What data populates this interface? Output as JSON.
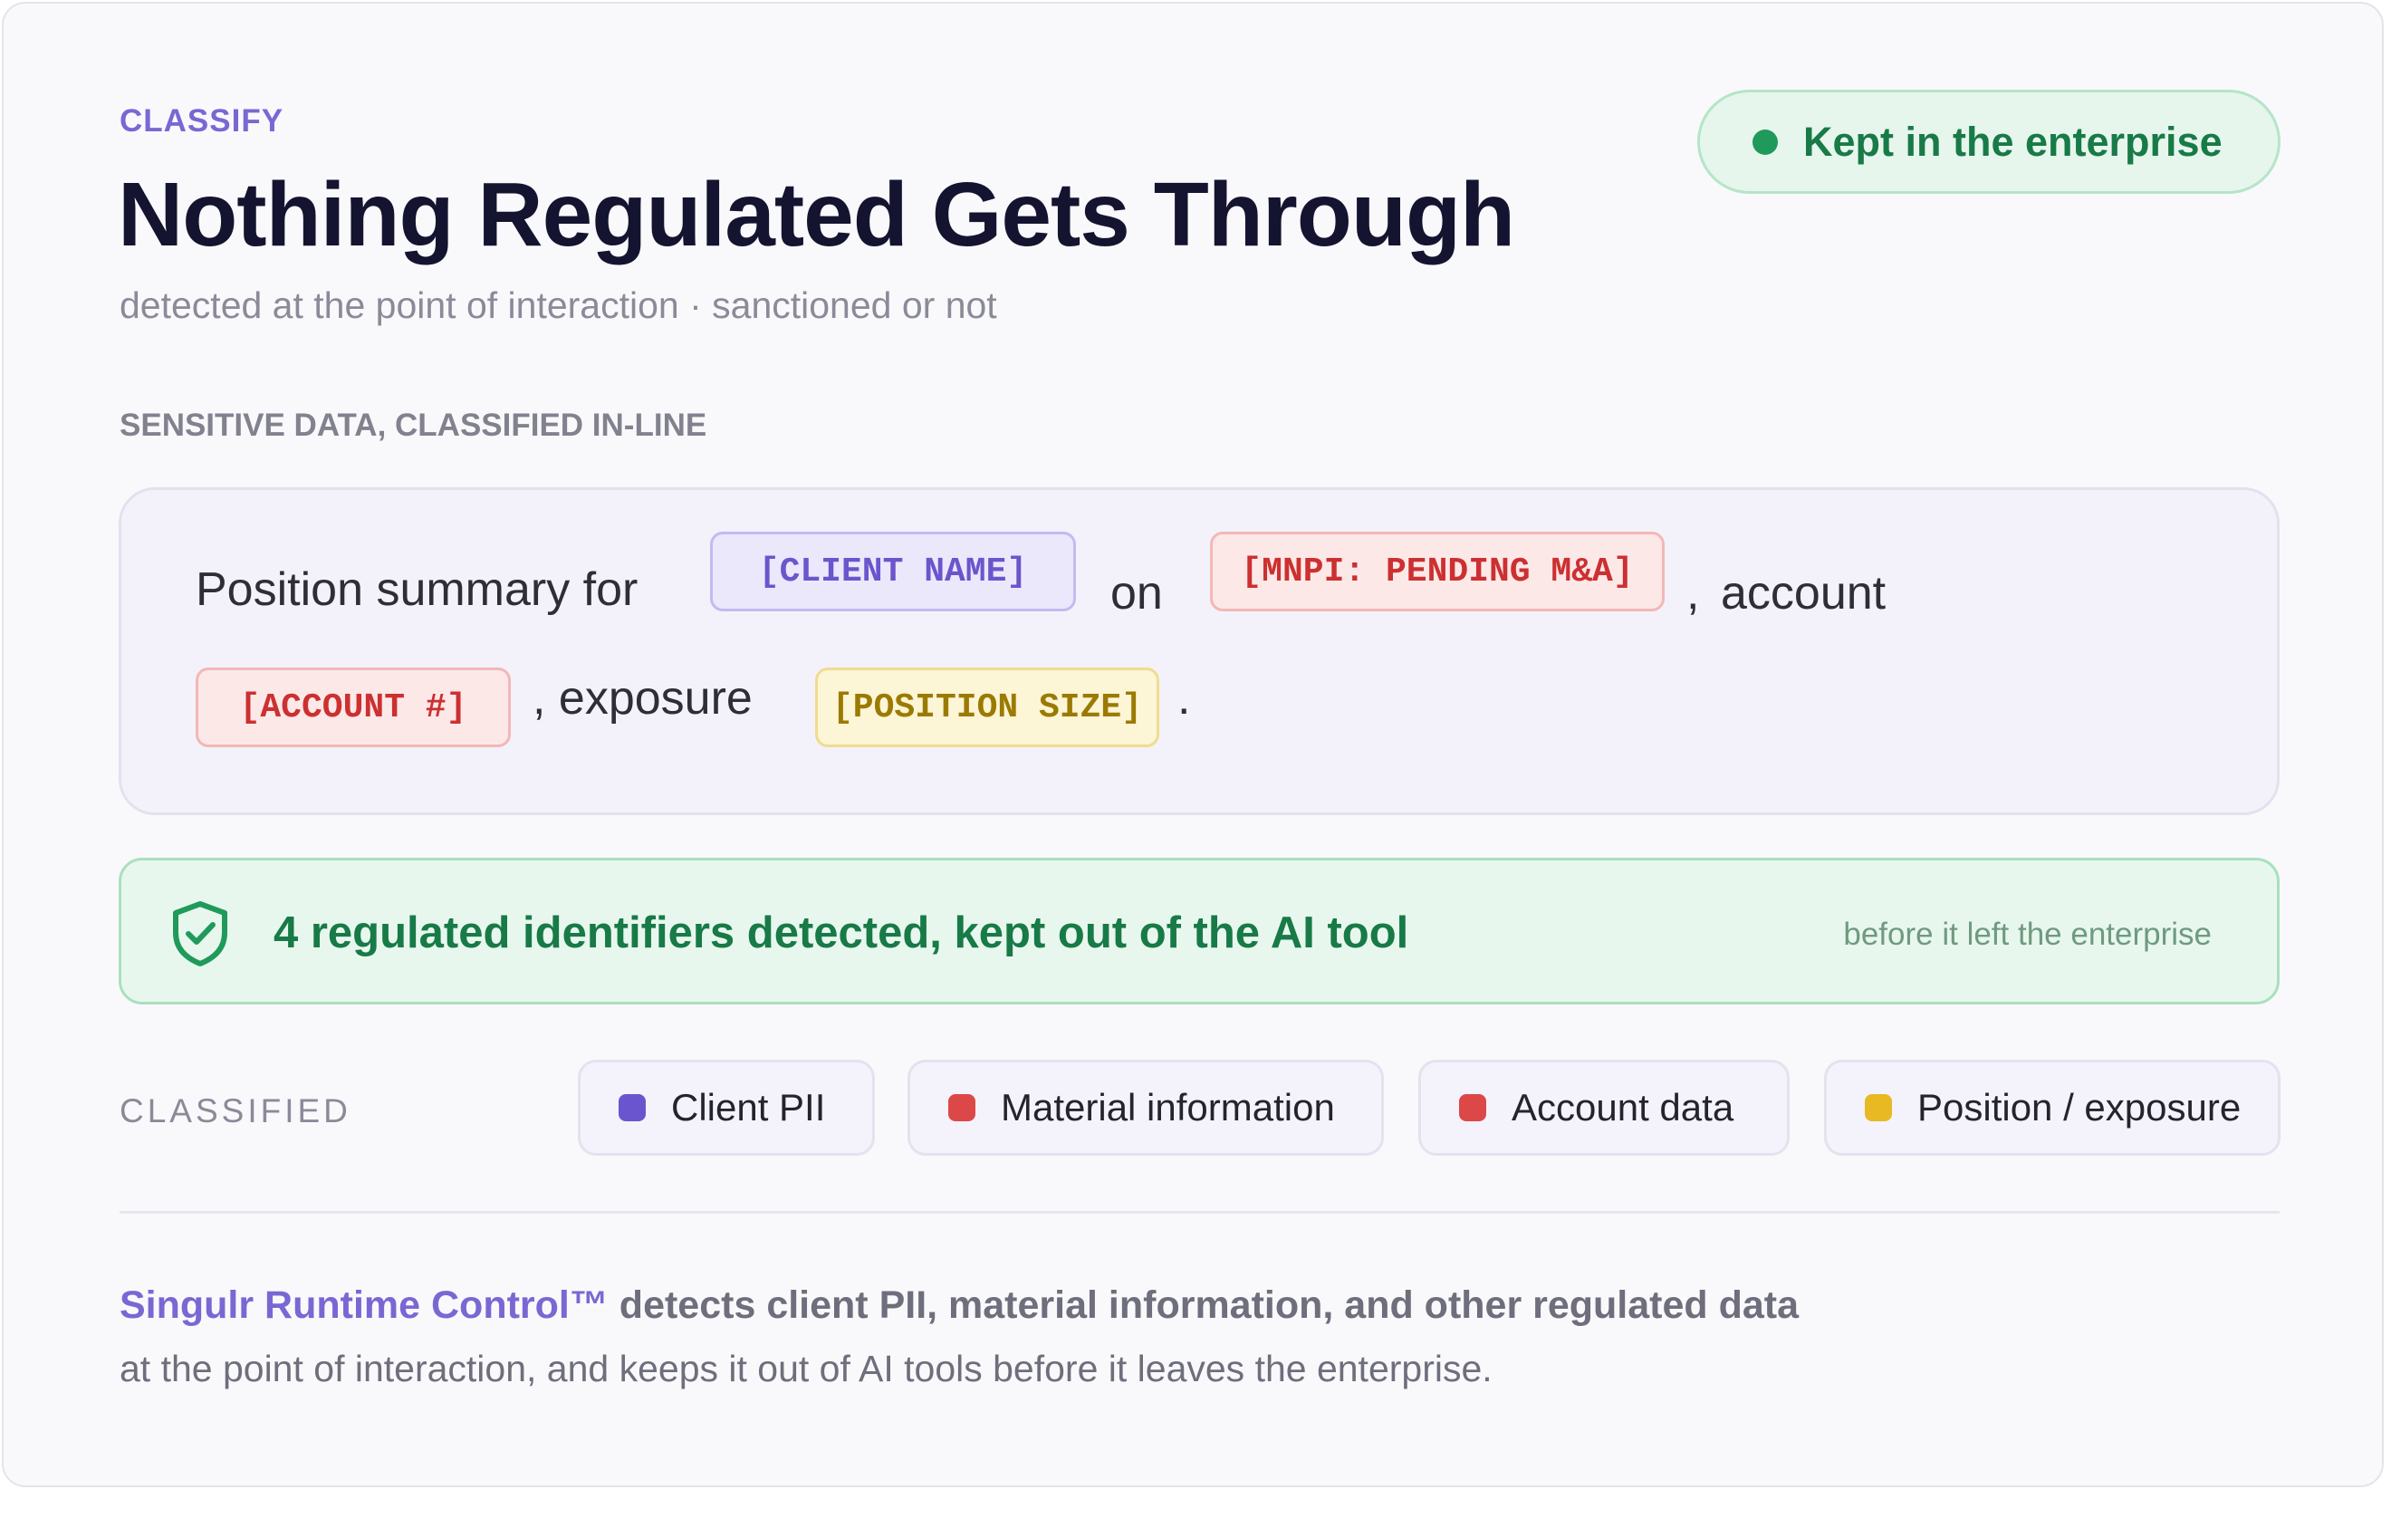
{
  "header": {
    "eyebrow": "CLASSIFY",
    "title": "Nothing Regulated Gets Through",
    "subtitle": "detected at the point of interaction · sanctioned or not",
    "status": {
      "label": "Kept in the enterprise",
      "color": "#1f9a5a"
    }
  },
  "section_label": "SENSITIVE DATA, CLASSIFIED IN-LINE",
  "prompt": {
    "text_1": "Position summary for",
    "chip_client": "[CLIENT NAME]",
    "text_2": "on",
    "chip_mnpi": "[MNPI: PENDING M&A]",
    "text_3": ",",
    "text_4": "account",
    "chip_account": "[ACCOUNT #]",
    "text_5": ", exposure",
    "chip_position": "[POSITION SIZE]",
    "text_6": "."
  },
  "result": {
    "icon": "shield-check-icon",
    "message": "4 regulated identifiers detected, kept out of the AI tool",
    "sub": "before it left the enterprise"
  },
  "classified": {
    "label": "CLASSIFIED",
    "tags": [
      {
        "label": "Client PII",
        "color": "#6a55cf"
      },
      {
        "label": "Material information",
        "color": "#dc4848"
      },
      {
        "label": "Account data",
        "color": "#dc4848"
      },
      {
        "label": "Position / exposure",
        "color": "#e8b923"
      }
    ]
  },
  "footer": {
    "brand": "Singulr Runtime Control™",
    "line_1": " detects client PII, material information, and other regulated data",
    "line_2": "at the point of interaction, and keeps it out of AI tools before it leaves the enterprise."
  }
}
